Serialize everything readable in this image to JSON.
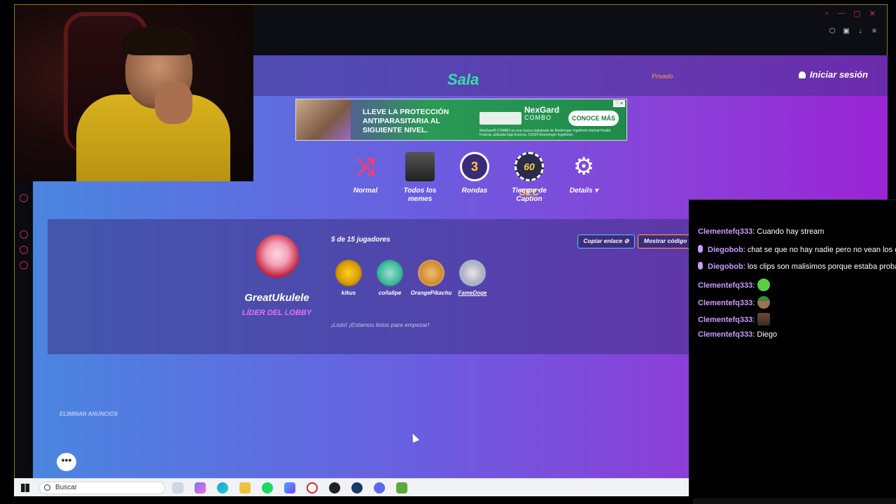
{
  "header": {
    "title": "Sala",
    "privacy": "Privado",
    "login": "Iniciar sesión"
  },
  "ad": {
    "headline": "LLEVE LA PROTECCIÓN ANTIPARASITARIA AL SIGUIENTE NIVEL.",
    "brand": "NexGard",
    "brand_sub": "COMBO",
    "fineprint": "NexGard® COMBO es una marca registrada de Boehringer Ingelheim Animal Health Francia, utilizada bajo licencia. ©2024 Boehringer Ingelheim.",
    "cta": "CONOCE MÁS"
  },
  "settings": [
    {
      "label": "Normal",
      "icon": "shuffle-icon"
    },
    {
      "label": "Todos los memes",
      "icon": "meme-pack-icon"
    },
    {
      "label": "Rondas",
      "icon": "rounds-icon",
      "value": "3"
    },
    {
      "label": "Tiempo de Caption",
      "icon": "timer-icon",
      "value": "60 SEC"
    },
    {
      "label": "Details",
      "icon": "gear-icon"
    }
  ],
  "lobby": {
    "leader_name": "GreatUkulele",
    "leader_role": "LÍDER DEL LOBBY",
    "players_count": "5 de 15 jugadores",
    "copy_link": "Copiar enlace",
    "show_code": "Mostrar código",
    "ready_text": "¡Listo! ¡Estamos listos para empezar!",
    "players": [
      {
        "name": "kikus"
      },
      {
        "name": "coñalipe"
      },
      {
        "name": "OrangePikachu"
      },
      {
        "name": "FameDoge"
      }
    ]
  },
  "remove_ads": "ELIMINAR ANUNCIOS",
  "chat": {
    "messages": [
      {
        "user": "Clementefq333",
        "text": ": Cuando hay stream",
        "badge": false
      },
      {
        "user": "Diegobob",
        "text": ": chat se que no hay nadie pero no vean los c",
        "badge": true
      },
      {
        "user": "Diegobob",
        "text": ": los clips son malisimos porque estaba proba",
        "badge": true
      },
      {
        "user": "Clementefq333",
        "text": ":",
        "badge": false,
        "emote": "green-face-emote"
      },
      {
        "user": "Clementefq333",
        "text": ":",
        "badge": false,
        "emote": "hat-emote"
      },
      {
        "user": "Clementefq333",
        "text": ":",
        "badge": false,
        "emote": "man-emote"
      },
      {
        "user": "Clementefq333",
        "text": ": Diego",
        "badge": false
      }
    ]
  },
  "taskbar": {
    "search_placeholder": "Buscar"
  },
  "colors": {
    "accent_green": "#35e0a8",
    "accent_pink": "#e070ff",
    "chat_user": "#c99cff"
  }
}
